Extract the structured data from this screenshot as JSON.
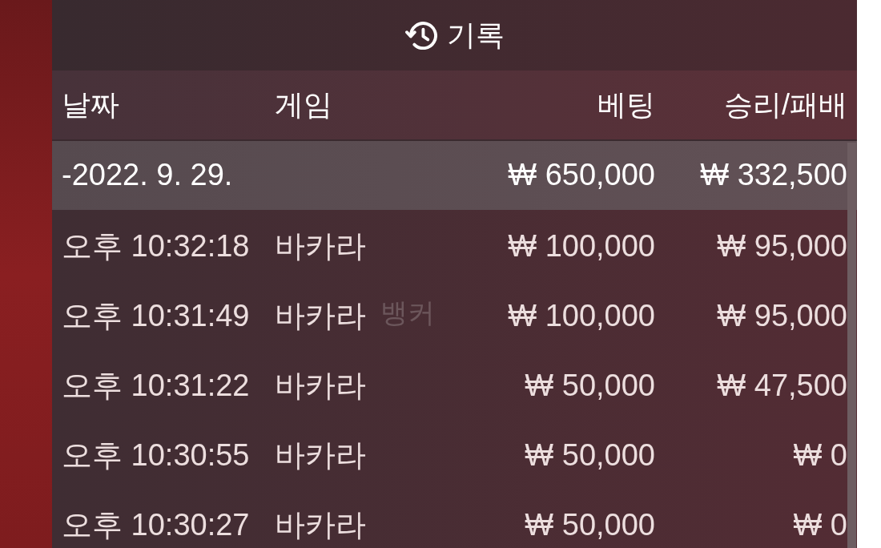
{
  "title": {
    "text": "기록"
  },
  "table": {
    "columns": [
      "날짜",
      "게임",
      "베팅",
      "승리/패배"
    ],
    "groups": [
      {
        "date": "-2022. 9. 29.",
        "bet_total": "₩ 650,000",
        "result_total": "₩ 332,500",
        "rows": [
          {
            "time": "오후 10:32:18",
            "game": "바카라",
            "bet": "₩ 100,000",
            "result": "₩ 95,000"
          },
          {
            "time": "오후 10:31:49",
            "game": "바카라",
            "bet": "₩ 100,000",
            "result": "₩ 95,000"
          },
          {
            "time": "오후 10:31:22",
            "game": "바카라",
            "bet": "₩ 50,000",
            "result": "₩ 47,500"
          },
          {
            "time": "오후 10:30:55",
            "game": "바카라",
            "bet": "₩ 50,000",
            "result": "₩ 0"
          },
          {
            "time": "오후 10:30:27",
            "game": "바카라",
            "bet": "₩ 50,000",
            "result": "₩ 0"
          }
        ]
      }
    ]
  },
  "background_text": "뱅커"
}
